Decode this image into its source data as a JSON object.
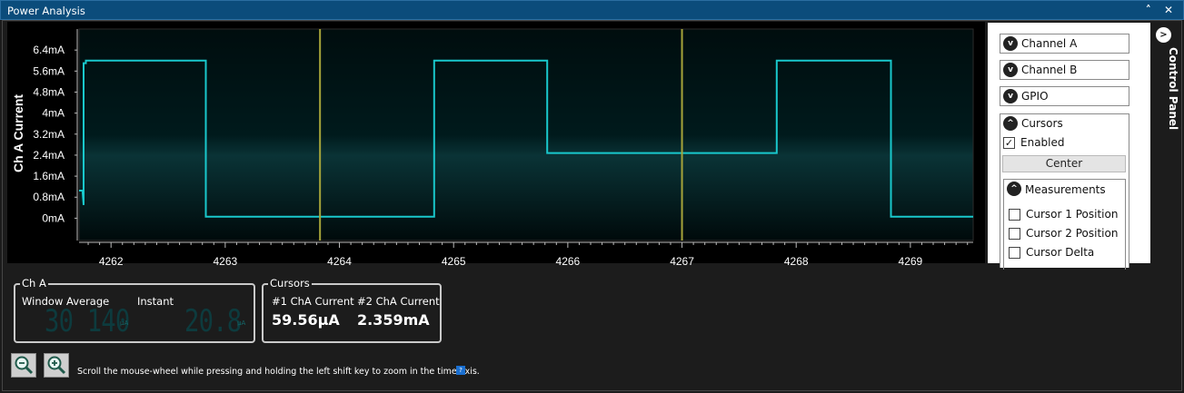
{
  "window": {
    "title": "Power Analysis",
    "collapse_label": "˄",
    "close_label": "✕"
  },
  "colors": {
    "trace": "#19c8cc",
    "cursor": "#a6a43a",
    "plot_background": "#001a1c",
    "title_bar": "#0b4c7b"
  },
  "chart_data": {
    "type": "line",
    "ylabel": "Ch A Current",
    "xlabel": "",
    "yticks": [
      "6.4mA",
      "5.6mA",
      "4.8mA",
      "4mA",
      "3.2mA",
      "2.4mA",
      "1.6mA",
      "0.8mA",
      "0mA"
    ],
    "xticks": [
      "4262",
      "4263",
      "4264",
      "4265",
      "4266",
      "4267",
      "4268",
      "4269"
    ],
    "xlim": [
      4261.72,
      4269.55
    ],
    "ylim_mA": [
      -0.85,
      7.2
    ],
    "grid": false,
    "series": [
      {
        "x": [
          4261.72,
          4261.75,
          4261.76,
          4261.76,
          4261.78,
          4261.78,
          4262.83,
          4262.83,
          4264.83,
          4264.83,
          4265.82,
          4265.82,
          4266.83,
          4266.83,
          4267.83,
          4267.83,
          4268.83,
          4268.83,
          4269.55
        ],
        "y_mA": [
          1.05,
          1.05,
          0.5,
          5.9,
          5.9,
          6.0,
          6.0,
          0.06,
          0.06,
          6.0,
          6.0,
          2.48,
          2.48,
          2.48,
          2.48,
          6.0,
          6.0,
          0.06,
          0.06
        ]
      }
    ],
    "cursors": [
      {
        "x": 4263.83
      },
      {
        "x": 4267.0
      }
    ]
  },
  "channel_a": {
    "legend": "Ch A",
    "window_average_label": "Window Average",
    "instant_label": "Instant",
    "window_average_value": "30 140",
    "window_average_unit": "µA",
    "instant_value": "20.8",
    "instant_unit": "µA"
  },
  "cursors_group": {
    "legend": "Cursors",
    "c1_label": "#1 ChA Current",
    "c2_label": "#2 ChA Current",
    "c1_value": "59.56µA",
    "c2_value": "2.359mA"
  },
  "control_panel": {
    "tab_label": "Control Panel",
    "sections": {
      "channel_a": "Channel A",
      "channel_b": "Channel B",
      "gpio": "GPIO",
      "cursors": "Cursors"
    },
    "enabled_label": "Enabled",
    "enabled_checked": true,
    "center_label": "Center",
    "measurements_label": "Measurements",
    "measurements": [
      {
        "label": "Cursor 1 Position",
        "checked": false
      },
      {
        "label": "Cursor 2 Position",
        "checked": false
      },
      {
        "label": "Cursor Delta",
        "checked": false
      }
    ]
  },
  "footer": {
    "hint": "Scroll the mouse-wheel while pressing and holding the left shift key to zoom in the time axis.",
    "help_icon_label": "?"
  }
}
